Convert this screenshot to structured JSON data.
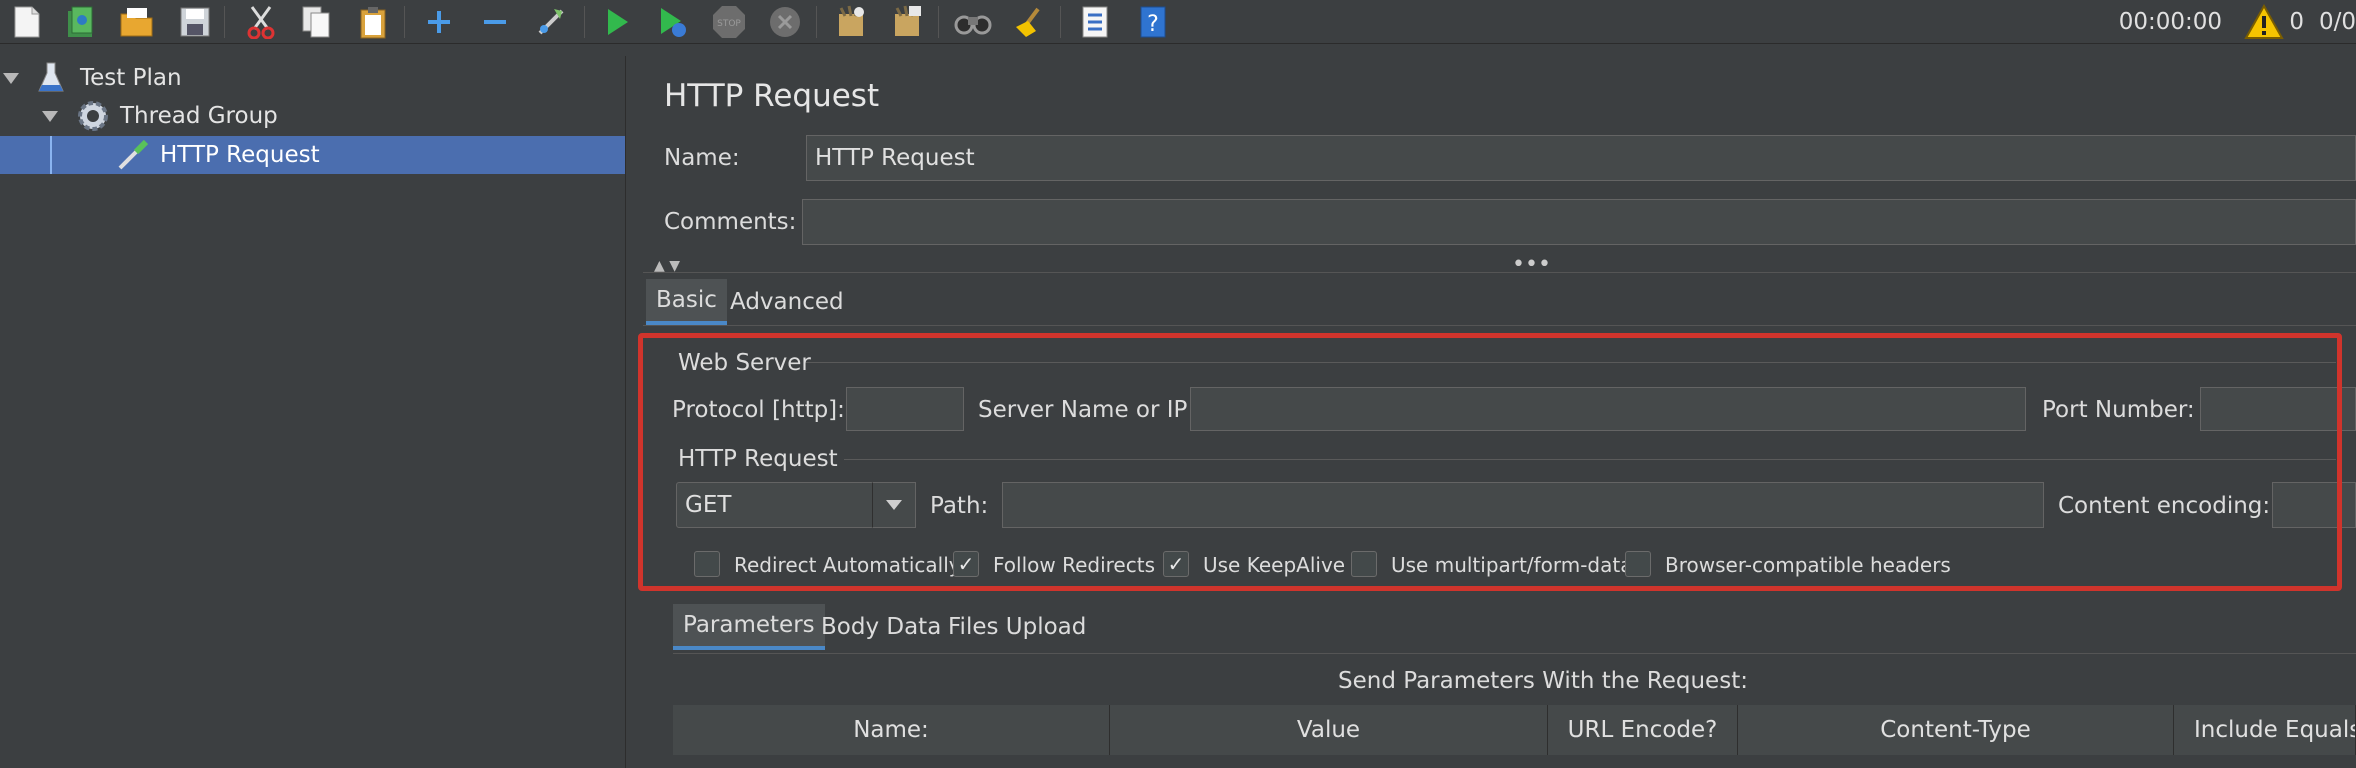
{
  "status": {
    "timer": "00:00:00",
    "warnings": "0",
    "threads": "0/0"
  },
  "tree": [
    {
      "label": "Test Plan"
    },
    {
      "label": "Thread Group"
    },
    {
      "label": "HTTP Request"
    }
  ],
  "form": {
    "title": "HTTP Request",
    "name_label": "Name:",
    "name_value": "HTTP Request",
    "comments_label": "Comments:",
    "comments_value": ""
  },
  "tabs": [
    "Basic",
    "Advanced"
  ],
  "web_server": {
    "legend": "Web Server",
    "protocol_label": "Protocol [http]:",
    "protocol_value": "",
    "server_label": "Server Name or IP:",
    "server_value": "",
    "port_label": "Port Number:",
    "port_value": ""
  },
  "http_request": {
    "legend": "HTTP Request",
    "method": "GET",
    "path_label": "Path:",
    "path_value": "",
    "encoding_label": "Content encoding:",
    "encoding_value": ""
  },
  "checkboxes": [
    {
      "label": "Redirect Automatically",
      "checked": false
    },
    {
      "label": "Follow Redirects",
      "checked": true
    },
    {
      "label": "Use KeepAlive",
      "checked": true
    },
    {
      "label": "Use multipart/form-data",
      "checked": false
    },
    {
      "label": "Browser-compatible headers",
      "checked": false
    }
  ],
  "sub_tabs": [
    "Parameters",
    "Body Data",
    "Files Upload"
  ],
  "params": {
    "caption": "Send Parameters With the Request:",
    "columns": [
      "Name:",
      "Value",
      "URL Encode?",
      "Content-Type",
      "Include Equals?"
    ]
  },
  "colors": {
    "selection": "#4b6eaf",
    "highlight": "#d0342c",
    "background": "#3c3f41"
  }
}
